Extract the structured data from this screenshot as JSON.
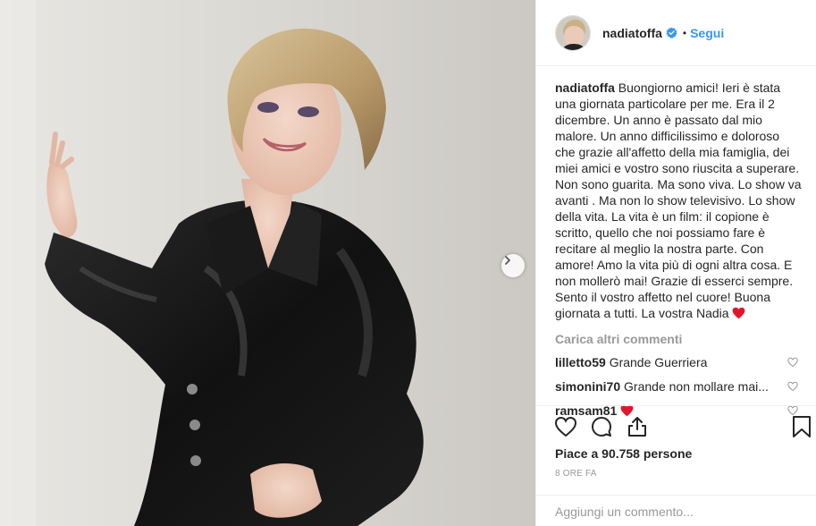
{
  "post": {
    "username": "nadiatoffa",
    "verified": true,
    "follow_label": "Segui",
    "separator": "•",
    "caption_user": "nadiatoffa",
    "caption_text": "Buongiorno amici! Ieri è stata una giornata particolare per me. Era il 2 dicembre. Un anno è passato dal mio malore. Un anno difficilissimo e doloroso che grazie all'affetto della mia famiglia, dei miei amici e vostro sono riuscita a superare. Non sono guarita. Ma sono viva. Lo show va avanti . Ma non lo show televisivo. Lo show della vita. La vita è un film: il copione è scritto, quello che noi possiamo fare è recitare al meglio la nostra parte. Con amore! Amo la vita più di ogni altra cosa. E non mollerò mai! Grazie di esserci sempre. Sento il vostro affetto nel cuore! Buona giornata a tutti. La vostra Nadia",
    "load_more": "Carica altri commenti",
    "comments": [
      {
        "user": "lilletto59",
        "text": "Grande Guerriera"
      },
      {
        "user": "simonini70",
        "text": "Grande non mollare mai..."
      },
      {
        "user": "ramsam81",
        "text": ""
      }
    ],
    "likes_text": "Piace a 90.758 persone",
    "time_ago": "8 ORE FA",
    "add_comment_placeholder": "Aggiungi un commento..."
  },
  "icons": {
    "verified": "verified-badge-icon",
    "like": "heart-icon",
    "comment": "comment-icon",
    "share": "share-icon",
    "save": "bookmark-icon",
    "next": "chevron-right-icon"
  },
  "colors": {
    "accent": "#3897f0",
    "heart": "#e0162b",
    "muted": "#999999"
  }
}
